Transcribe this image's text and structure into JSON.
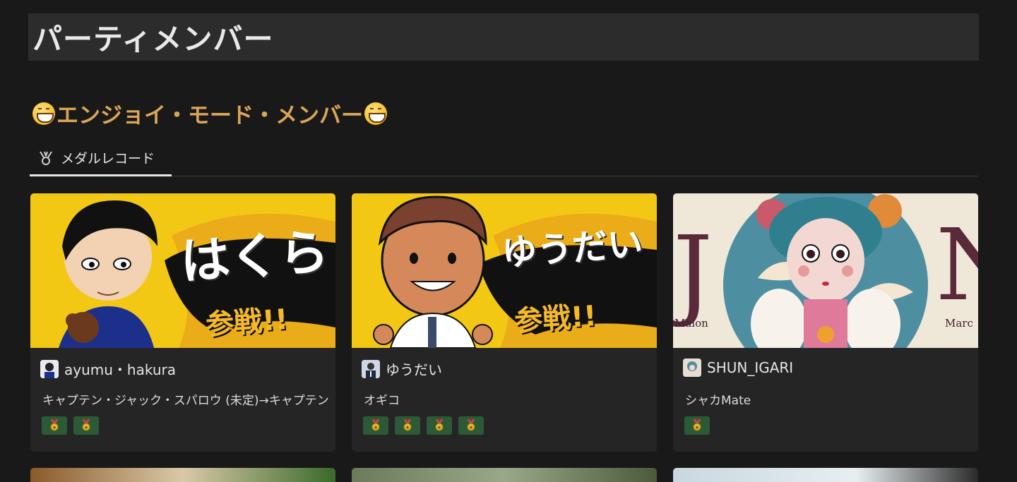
{
  "page": {
    "title": "パーティメンバー"
  },
  "section": {
    "heading": "エンジョイ・モード・メンバー",
    "heading_color": "#d9a557",
    "emoji_icon": "grinning-face-icon"
  },
  "tabs": [
    {
      "label": "メダルレコード",
      "icon": "medal-record-icon",
      "active": true
    }
  ],
  "cards": [
    {
      "name": "ayumu・hakura",
      "role": "キャプテン・ジャック・スパロウ (未定)→キャプテン",
      "cover_text": "はくら",
      "cover_sub": "参戦!!",
      "medals": 2
    },
    {
      "name": "ゆうだい",
      "role": "オギコ",
      "cover_text": "ゆうだい",
      "cover_sub": "参戦!!",
      "medals": 4
    },
    {
      "name": "SHUN_IGARI",
      "role": "シャカMate",
      "cover_left_label": "Maion",
      "cover_right_label": "Marc",
      "medals": 1
    }
  ],
  "colors": {
    "background": "#191919",
    "card": "#252525",
    "medal_bg": "#2c5a36",
    "cover_yellow": "#f3c814"
  }
}
